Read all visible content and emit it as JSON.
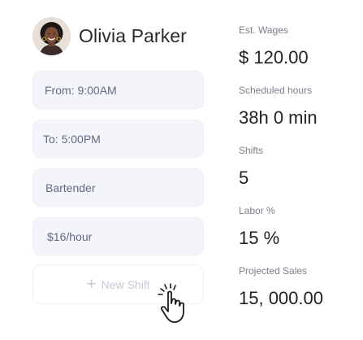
{
  "profile": {
    "name": "Olivia Parker"
  },
  "form": {
    "from": "From: 9:00AM",
    "to": "To: 5:00PM",
    "role": "Bartender",
    "rate": "$16/hour",
    "new_shift_label": "New Shift",
    "new_shift_icon": "plus-icon"
  },
  "stats": [
    {
      "label": "Est. Wages",
      "value": "$ 120.00"
    },
    {
      "label": "Scheduled hours",
      "value": "38h 0 min"
    },
    {
      "label": "Shifts",
      "value": "5"
    },
    {
      "label": "Labor %",
      "value": "15 %"
    },
    {
      "label": "Projected Sales",
      "value": "15, 000.00"
    }
  ]
}
